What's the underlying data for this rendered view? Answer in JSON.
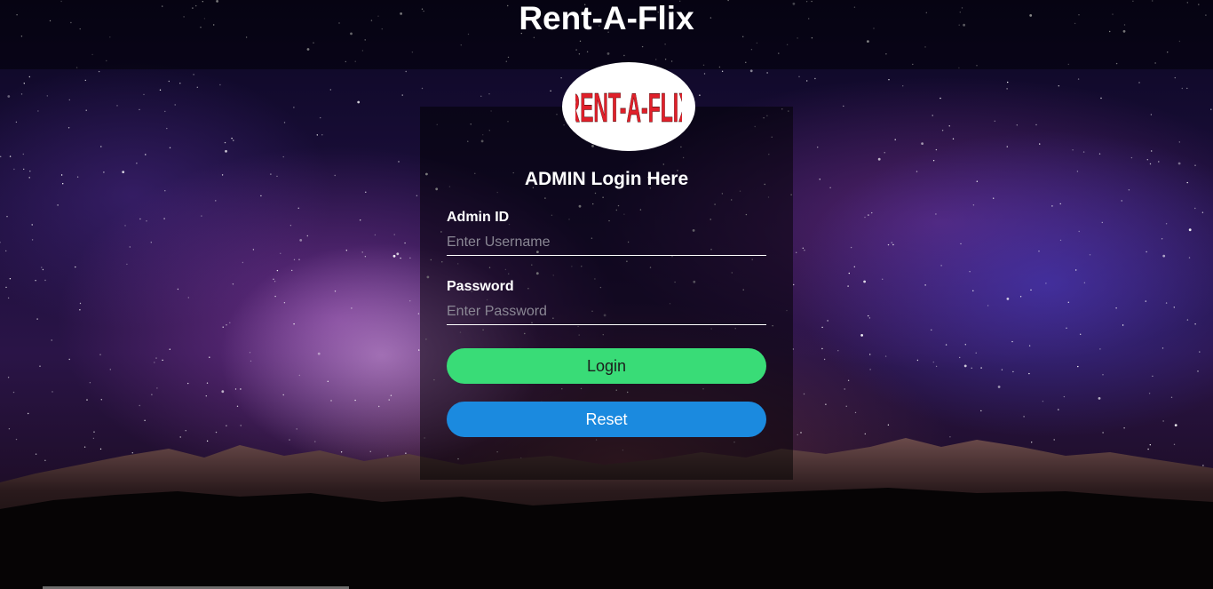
{
  "header": {
    "title": "Rent-A-Flix"
  },
  "logo": {
    "text": "RENT-A-FLIX"
  },
  "login": {
    "heading": "ADMIN Login Here",
    "admin_id": {
      "label": "Admin ID",
      "placeholder": "Enter Username",
      "value": ""
    },
    "password": {
      "label": "Password",
      "placeholder": "Enter Password",
      "value": ""
    },
    "login_button": "Login",
    "reset_button": "Reset"
  },
  "colors": {
    "login_button": "#39dc77",
    "reset_button": "#1b8adf",
    "logo_text": "#e0202a"
  }
}
